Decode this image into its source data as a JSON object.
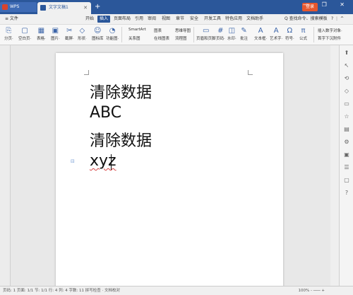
{
  "titlebar": {
    "app_tab": "WPS",
    "doc_tab": "文字文稿1",
    "new_tab": "+",
    "login": "登录",
    "controls": "— ❐ ✕"
  },
  "menu": {
    "file": "≡ 文件",
    "items": [
      "开始",
      "插入",
      "页面布局",
      "引用",
      "审阅",
      "视图",
      "章节",
      "安全",
      "开发工具",
      "特色应用",
      "文档助手"
    ],
    "active": "插入",
    "search": "Q 查找命令、搜索模板",
    "right": "? ⋮ ^"
  },
  "ribbon": {
    "items": [
      {
        "label": "分页·",
        "glyph": "⎘"
      },
      {
        "label": "空白页·",
        "glyph": "▢"
      },
      {
        "label": "表格·",
        "glyph": "▦"
      },
      {
        "label": "图片·",
        "glyph": "▣"
      },
      {
        "label": "截屏·",
        "glyph": "✂"
      },
      {
        "label": "形状·",
        "glyph": "◇"
      },
      {
        "label": "图标库",
        "glyph": "☺"
      },
      {
        "label": "功能图·",
        "glyph": "◔"
      }
    ],
    "group2": [
      "SmartArt",
      "关系图",
      "图表",
      "在线图表",
      "思维导图",
      "流程图"
    ],
    "group3": [
      {
        "label": "页眉和页脚",
        "glyph": "▭"
      },
      {
        "label": "页码·",
        "glyph": "#"
      },
      {
        "label": "水印·",
        "glyph": "◫"
      },
      {
        "label": "批注",
        "glyph": "✎"
      },
      {
        "label": "文本框·",
        "glyph": "A"
      },
      {
        "label": "艺术字·",
        "glyph": "A"
      },
      {
        "label": "符号·",
        "glyph": "Ω"
      },
      {
        "label": "公式",
        "glyph": "π"
      }
    ],
    "group4": [
      "插入数字",
      "对象·",
      "首字下沉",
      "附件",
      "日期",
      "文档部件"
    ]
  },
  "document": {
    "lines": [
      "清除数据",
      "ABC",
      "清除数据",
      "xyz"
    ]
  },
  "status": {
    "text": "页码: 1  页面: 1/1  节: 1/1  行: 4  列: 4  字数: 11   拼写检查 · 文档校对",
    "zoom": "100% - ─── +"
  },
  "colors": {
    "title_bar": "#2b579a",
    "active_tab": "#2b579a",
    "spell_underline": "#d64545",
    "login_button": "#e6572e"
  }
}
